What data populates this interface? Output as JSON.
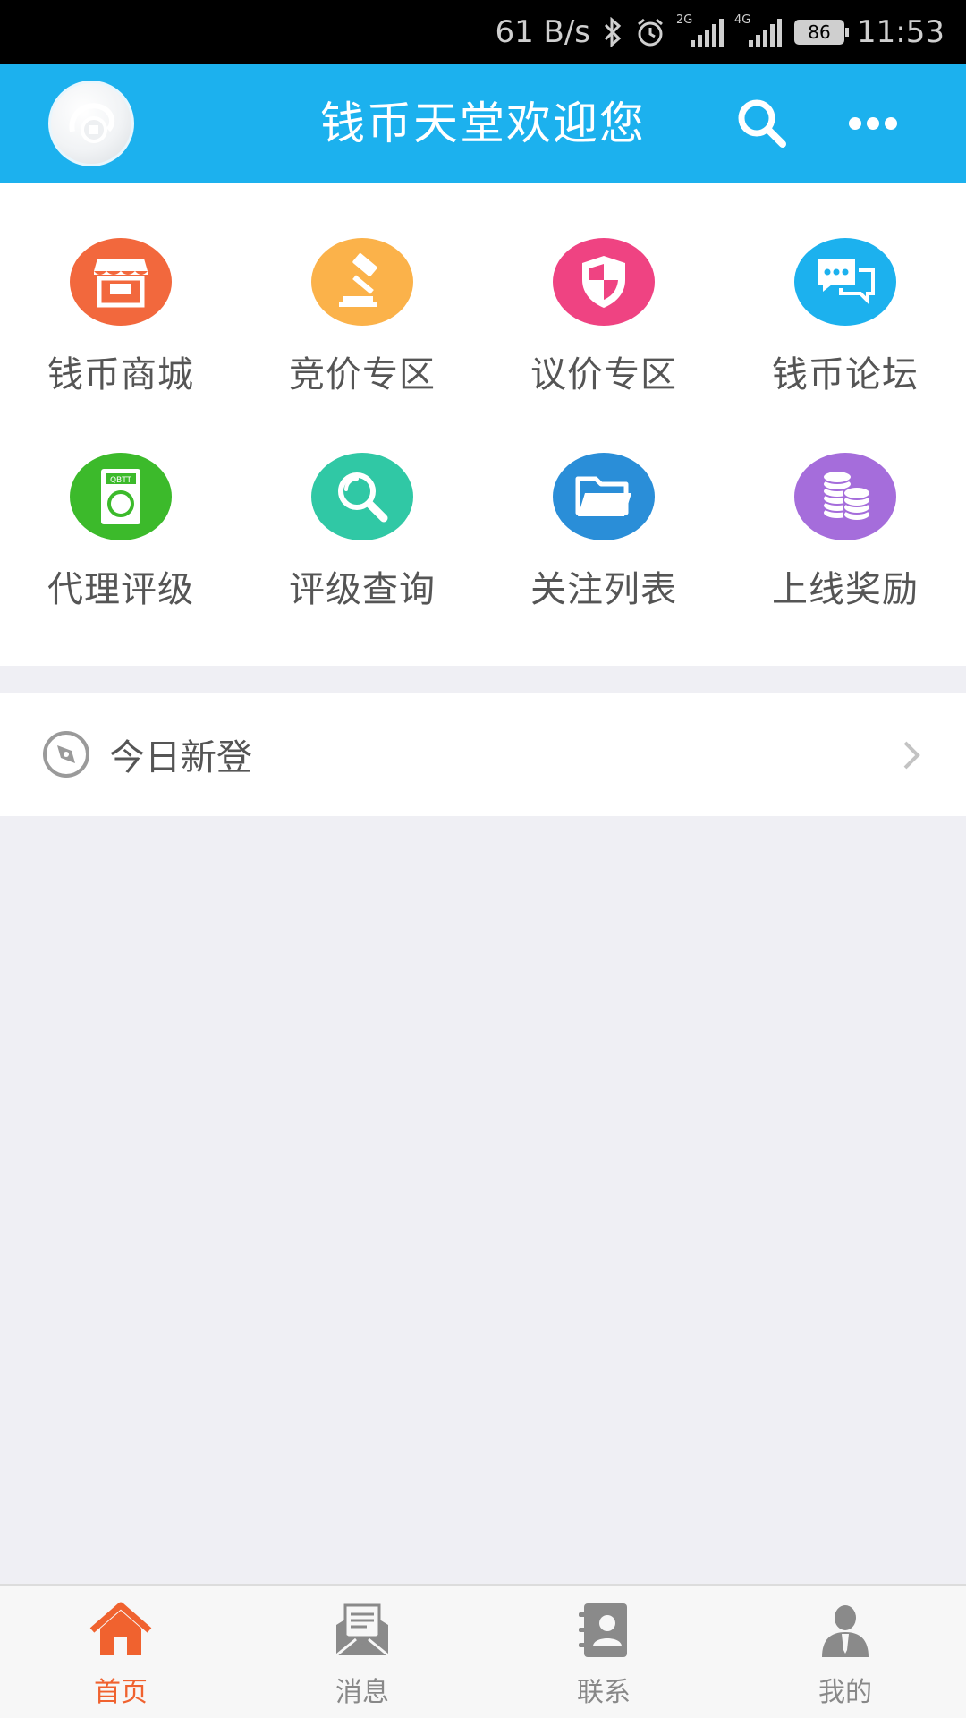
{
  "status_bar": {
    "net_speed": "61 B/s",
    "signal1_tag": "2G",
    "signal2_tag": "4G",
    "battery": "86",
    "time": "11:53"
  },
  "header": {
    "title": "钱币天堂欢迎您",
    "color": "#1cb1ee"
  },
  "grid": [
    {
      "label": "钱币商城",
      "icon": "store-icon",
      "color": "#f2683d"
    },
    {
      "label": "竞价专区",
      "icon": "gavel-icon",
      "color": "#fbb24a"
    },
    {
      "label": "议价专区",
      "icon": "shield-icon",
      "color": "#ef4382"
    },
    {
      "label": "钱币论坛",
      "icon": "chat-icon",
      "color": "#1cb1ee"
    },
    {
      "label": "代理评级",
      "icon": "grading-box-icon",
      "icon_text": "QBTT",
      "color": "#3cba2b"
    },
    {
      "label": "评级查询",
      "icon": "magnifier-icon",
      "color": "#30c8a5"
    },
    {
      "label": "关注列表",
      "icon": "folder-icon",
      "color": "#2a8ed8"
    },
    {
      "label": "上线奖励",
      "icon": "coins-icon",
      "color": "#a56ddb"
    }
  ],
  "list": {
    "today_new_label": "今日新登"
  },
  "tabs": [
    {
      "label": "首页",
      "icon": "home-icon",
      "active": true
    },
    {
      "label": "消息",
      "icon": "message-icon",
      "active": false
    },
    {
      "label": "联系",
      "icon": "contacts-icon",
      "active": false
    },
    {
      "label": "我的",
      "icon": "user-icon",
      "active": false
    }
  ],
  "colors": {
    "accent_active": "#f0622f",
    "tab_inactive": "#888888"
  }
}
